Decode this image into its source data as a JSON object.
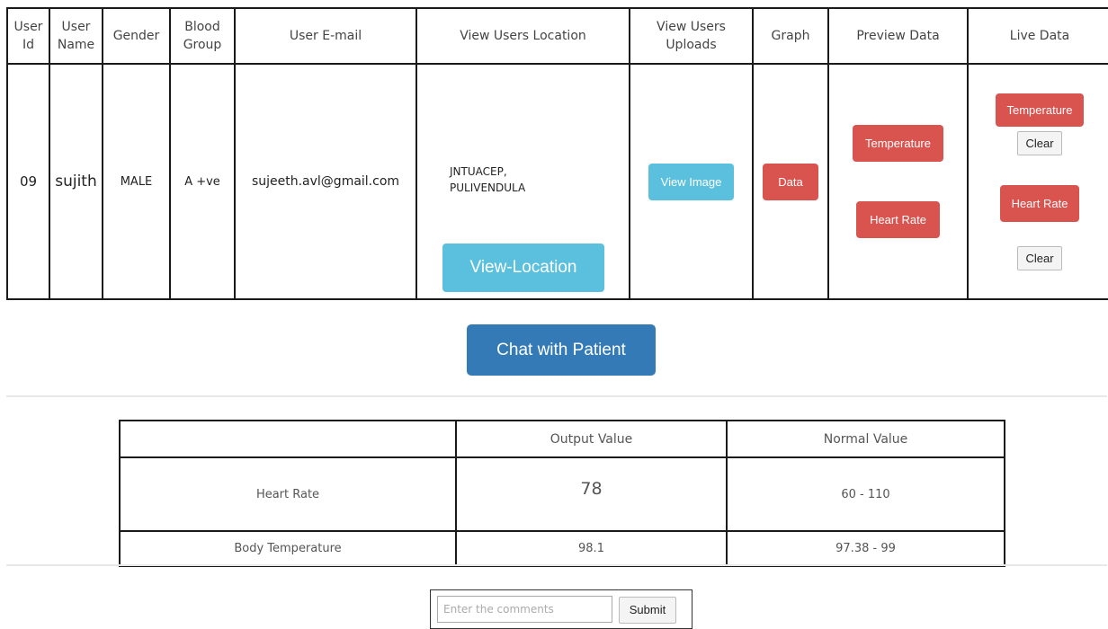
{
  "user_table": {
    "headers": [
      "User Id",
      "User Name",
      "Gender",
      "Blood Group",
      "User E-mail",
      "View Users Location",
      "View Users Uploads",
      "Graph",
      "Preview Data",
      "Live Data"
    ],
    "row": {
      "id": "09",
      "name": "sujith",
      "gender": "MALE",
      "blood_group": "A +ve",
      "email": "sujeeth.avl@gmail.com",
      "location_line1": "JNTUACEP,",
      "location_line2": "PULIVENDULA",
      "view_location_label": "View-Location",
      "view_image_label": "View Image",
      "graph_label": "Data",
      "preview_temperature_label": "Temperature",
      "preview_heart_rate_label": "Heart Rate",
      "live_temperature_label": "Temperature",
      "live_heart_rate_label": "Heart Rate",
      "clear_label": "Clear"
    }
  },
  "chat_button_label": "Chat with Patient",
  "values_table": {
    "headers": [
      "",
      "Output Value",
      "Normal Value"
    ],
    "rows": [
      {
        "name": "Heart Rate",
        "output": "78",
        "normal": "60 - 110"
      },
      {
        "name": "Body Temperature",
        "output": "98.1",
        "normal": "97.38 - 99"
      }
    ]
  },
  "comment_form": {
    "placeholder": "Enter the comments",
    "submit_label": "Submit"
  },
  "colors": {
    "info": "#5bc0de",
    "danger": "#d9534f",
    "primary": "#337ab7"
  }
}
